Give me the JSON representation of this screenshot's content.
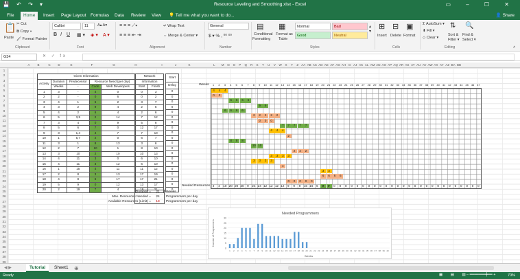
{
  "window": {
    "title": "Resource Leveling and Smoothing.xlsx - Excel"
  },
  "tabs": [
    "File",
    "Home",
    "Insert",
    "Page Layout",
    "Formulas",
    "Data",
    "Review",
    "View"
  ],
  "tell_me": "Tell me what you want to do...",
  "share": "Share",
  "ribbon": {
    "cut": "Cut",
    "copy": "Copy",
    "format_painter": "Format Painter",
    "paste": "Paste",
    "font": "Calibri",
    "font_size": "11",
    "wrap": "Wrap Text",
    "merge": "Merge & Center",
    "number_format": "General",
    "cond": "Conditional",
    "cond2": "Formatting",
    "fmt_table": "Format as",
    "fmt_table2": "Table",
    "styles": [
      "Normal",
      "Bad",
      "Good",
      "Neutral"
    ],
    "insert": "Insert",
    "delete": "Delete",
    "format": "Format",
    "autosum": "AutoSum",
    "fill": "Fill",
    "clear": "Clear",
    "sort": "Sort &",
    "sort2": "Filter",
    "find": "Find &",
    "find2": "Select",
    "groups": [
      "Clipboard",
      "Font",
      "Alignment",
      "Number",
      "Styles",
      "Cells",
      "Editing"
    ]
  },
  "namebox": "G34",
  "columns": [
    "A",
    "B",
    "C",
    "D",
    "E",
    "F",
    "G",
    "H",
    "I",
    "J",
    "K",
    "L",
    "M",
    "N",
    "O",
    "P",
    "Q",
    "R",
    "S",
    "T",
    "U",
    "V",
    "W",
    "X",
    "Y",
    "Z",
    "AA",
    "AB",
    "AC",
    "AD",
    "AE",
    "AF",
    "AG",
    "AH",
    "AI",
    "AJ",
    "AK",
    "AL",
    "AM",
    "AN",
    "AO",
    "AP",
    "AQ",
    "AR",
    "AS",
    "AT",
    "AU",
    "AV",
    "AW",
    "AX",
    "AY",
    "AZ",
    "BA",
    "BB"
  ],
  "rows": [
    "1",
    "2",
    "3",
    "4",
    "5",
    "6",
    "7",
    "8",
    "9",
    "10",
    "11",
    "12",
    "13",
    "14",
    "15",
    "16",
    "17",
    "18",
    "19",
    "20",
    "21",
    "22",
    "23",
    "24",
    "25",
    "26",
    "27",
    "28",
    "29",
    "30",
    "31",
    "32",
    "33",
    "34",
    "35",
    "36",
    "37",
    "38",
    "39"
  ],
  "given": {
    "title": "Given Information",
    "h_activity": "Activity",
    "h_duration": "Duration",
    "h_weeks": "Weeks",
    "h_pred": "Predecessor",
    "h_rn": "Resource Need (per day)",
    "h_col3": "Code",
    "h_web": "Web Developers",
    "rows": [
      [
        "1",
        "3",
        "-",
        "4",
        "0"
      ],
      [
        "2",
        "2",
        "-",
        "0",
        "6"
      ],
      [
        "3",
        "4",
        "1",
        "6",
        "2"
      ],
      [
        "4",
        "3",
        "2",
        "9",
        "4"
      ],
      [
        "5",
        "4",
        "2",
        "6",
        "4"
      ],
      [
        "6",
        "5",
        "3,5",
        "2",
        "14"
      ],
      [
        "7",
        "3",
        "4",
        "0",
        "9"
      ],
      [
        "8",
        "5",
        "6",
        "7",
        "0"
      ],
      [
        "9",
        "3",
        "1,4",
        "4",
        "7"
      ],
      [
        "10",
        "1",
        "5,7",
        "2",
        "0"
      ],
      [
        "11",
        "3",
        "1",
        "8",
        "13"
      ],
      [
        "12",
        "2",
        "7",
        "10",
        "1"
      ],
      [
        "13",
        "3",
        "10",
        "2",
        "10"
      ],
      [
        "14",
        "4",
        "11",
        "3",
        "0"
      ],
      [
        "15",
        "4",
        "11",
        "3",
        "12"
      ],
      [
        "16",
        "1",
        "15",
        "4",
        "11"
      ],
      [
        "17",
        "2",
        "8",
        "3",
        "13"
      ],
      [
        "18",
        "4",
        "8",
        "6",
        "17"
      ],
      [
        "19",
        "5",
        "9",
        "0",
        "12"
      ],
      [
        "20",
        "2",
        "19",
        "7",
        "4"
      ]
    ]
  },
  "network": {
    "title": "Network",
    "title2": "Information",
    "h_start": "Start",
    "h_finish": "Finish",
    "rows": [
      [
        "0",
        "3"
      ],
      [
        "0",
        "2"
      ],
      [
        "3",
        "7"
      ],
      [
        "2",
        "5"
      ],
      [
        "2",
        "6"
      ],
      [
        "7",
        "12"
      ],
      [
        "5",
        "8"
      ],
      [
        "12",
        "17"
      ],
      [
        "7",
        "10"
      ],
      [
        "6",
        "7"
      ],
      [
        "3",
        "6"
      ],
      [
        "8",
        "10"
      ],
      [
        "10",
        "13"
      ],
      [
        "6",
        "10"
      ],
      [
        "6",
        "10"
      ],
      [
        "11",
        "12"
      ],
      [
        "17",
        "19"
      ],
      [
        "17",
        "21"
      ],
      [
        "13",
        "17"
      ],
      [
        "19",
        "21"
      ]
    ]
  },
  "delay": {
    "title": "Start",
    "title2": "Delay",
    "rows": [
      "0",
      "0",
      "0",
      "0",
      "0",
      "0",
      "0",
      "0",
      "0",
      "0",
      "0",
      "0",
      "0",
      "0",
      "0",
      "0",
      "0",
      "0",
      "0",
      "0"
    ]
  },
  "weeks_label": "Weeks",
  "week_numbers": [
    "1",
    "2",
    "3",
    "4",
    "5",
    "6",
    "7",
    "8",
    "9",
    "10",
    "11",
    "12",
    "13",
    "14",
    "15",
    "16",
    "17",
    "18",
    "19",
    "20",
    "21",
    "22",
    "23",
    "24",
    "25",
    "26",
    "27",
    "28",
    "29",
    "30",
    "31",
    "32",
    "33",
    "34",
    "35",
    "36",
    "37",
    "38",
    "39",
    "40",
    "41",
    "42",
    "43",
    "44",
    "45",
    "46",
    "47"
  ],
  "gantt": [
    {
      "row": 0,
      "start": 0,
      "len": 3,
      "val": "4",
      "color": "#ffc000"
    },
    {
      "row": 1,
      "start": 0,
      "len": 2,
      "val": "0",
      "color": "#f4b084"
    },
    {
      "row": 2,
      "start": 3,
      "len": 4,
      "val": "6",
      "color": "#70ad47"
    },
    {
      "row": 3,
      "start": 8,
      "len": 2,
      "val": "9",
      "color": "#70ad47"
    },
    {
      "row": 4,
      "start": 2,
      "len": 4,
      "val": "6",
      "color": "#70ad47"
    },
    {
      "row": 5,
      "start": 7,
      "len": 5,
      "val": "2",
      "color": "#f4b084"
    },
    {
      "row": 6,
      "start": 8,
      "len": 3,
      "val": "0",
      "color": "#f4b084"
    },
    {
      "row": 7,
      "start": 12,
      "len": 5,
      "val": "7",
      "color": "#70ad47"
    },
    {
      "row": 8,
      "start": 10,
      "len": 3,
      "val": "4",
      "color": "#ffc000"
    },
    {
      "row": 9,
      "start": 13,
      "len": 1,
      "val": "2",
      "color": "#f4b084"
    },
    {
      "row": 10,
      "start": 3,
      "len": 3,
      "val": "8",
      "color": "#70ad47"
    },
    {
      "row": 11,
      "start": 7,
      "len": 2,
      "val": "10",
      "color": "#70ad47"
    },
    {
      "row": 12,
      "start": 14,
      "len": 3,
      "val": "2",
      "color": "#f4b084"
    },
    {
      "row": 13,
      "start": 10,
      "len": 4,
      "val": "3",
      "color": "#ffc000"
    },
    {
      "row": 14,
      "start": 7,
      "len": 4,
      "val": "3",
      "color": "#ffc000"
    },
    {
      "row": 15,
      "start": 12,
      "len": 1,
      "val": "4",
      "color": "#f4b084"
    },
    {
      "row": 16,
      "start": 19,
      "len": 2,
      "val": "3",
      "color": "#ffc000"
    },
    {
      "row": 17,
      "start": 19,
      "len": 4,
      "val": "6",
      "color": "#f4b084"
    },
    {
      "row": 18,
      "start": 13,
      "len": 5,
      "val": "0",
      "color": "#f4b084"
    },
    {
      "row": 19,
      "start": 19,
      "len": 2,
      "val": "7",
      "color": "#70ad47"
    }
  ],
  "needed_label": "Needed Resources",
  "needed": [
    "4",
    "4",
    "10",
    "20",
    "20",
    "20",
    "9",
    "24",
    "24",
    "12",
    "12",
    "12",
    "12",
    "9",
    "9",
    "9",
    "16",
    "16",
    "6",
    "6",
    "0",
    "0",
    "0",
    "0",
    "0",
    "0",
    "0",
    "0",
    "0",
    "0",
    "0",
    "0",
    "0",
    "0",
    "0",
    "0",
    "0",
    "0",
    "0",
    "0",
    "0",
    "0",
    "0",
    "0",
    "0",
    "0",
    "0"
  ],
  "summary": [
    {
      "label": "Duration =",
      "value": "21",
      "unit": "Weeks"
    },
    {
      "label": "Max. Resources Needed =",
      "value": "24",
      "unit": "Programmers per day"
    },
    {
      "label": "Available Resources (Limit) =",
      "value": "18",
      "unit": "Programmers per day"
    }
  ],
  "chart_data": {
    "type": "bar",
    "title": "Needed Programmers",
    "xlabel": "Weeks",
    "ylabel": "Number of Programmers",
    "ylim": [
      0,
      30
    ],
    "yticks": [
      "0",
      "5",
      "10",
      "15",
      "20",
      "25",
      "30"
    ],
    "categories": [
      "1",
      "2",
      "3",
      "4",
      "5",
      "6",
      "7",
      "8",
      "9",
      "10",
      "11",
      "12",
      "13",
      "14",
      "15",
      "16",
      "17",
      "18",
      "19",
      "20",
      "21",
      "22",
      "23",
      "24",
      "25",
      "26",
      "27",
      "28",
      "29",
      "30",
      "31",
      "32",
      "33",
      "34",
      "35",
      "36",
      "37",
      "38",
      "39",
      "40"
    ],
    "values": [
      4,
      4,
      10,
      20,
      20,
      20,
      9,
      24,
      24,
      12,
      12,
      12,
      12,
      9,
      9,
      9,
      16,
      16,
      6,
      6,
      0,
      0,
      0,
      0,
      0,
      0,
      0,
      0,
      0,
      0,
      0,
      0,
      0,
      0,
      0,
      0,
      0,
      0,
      0,
      0
    ]
  },
  "sheets": [
    "Tutorial",
    "Sheet1"
  ],
  "status": {
    "ready": "Ready",
    "zoom": "70%"
  }
}
